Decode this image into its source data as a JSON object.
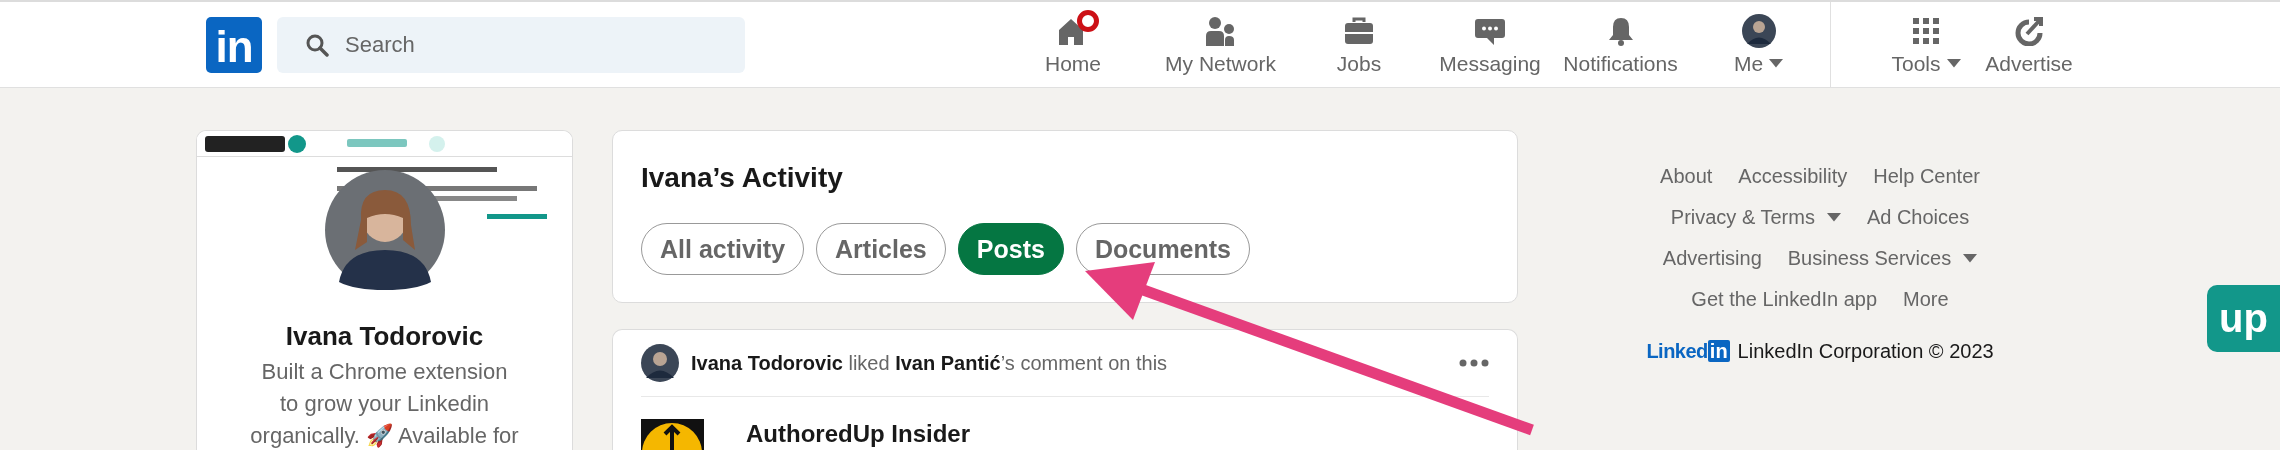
{
  "nav": {
    "logo": "in",
    "search": {
      "placeholder": "Search"
    },
    "items": [
      {
        "label": "Home",
        "kind": "home",
        "dropdown": false,
        "notification": true
      },
      {
        "label": "My Network",
        "kind": "network",
        "dropdown": false,
        "notification": false
      },
      {
        "label": "Jobs",
        "kind": "jobs",
        "dropdown": false,
        "notification": false
      },
      {
        "label": "Messaging",
        "kind": "messaging",
        "dropdown": false,
        "notification": false
      },
      {
        "label": "Notifications",
        "kind": "notifications",
        "dropdown": false,
        "notification": false
      },
      {
        "label": "Me",
        "kind": "me",
        "dropdown": true,
        "notification": false
      },
      {
        "label": "Tools",
        "kind": "tools",
        "dropdown": true,
        "notification": false
      },
      {
        "label": "Advertise",
        "kind": "advertise",
        "dropdown": false,
        "notification": false
      }
    ]
  },
  "profile": {
    "name": "Ivana Todorovic",
    "headline": "Built a Chrome extension\nto grow your Linkedin\norganically. 🚀 Available for"
  },
  "activity": {
    "title": "Ivana’s Activity",
    "filters": [
      {
        "label": "All activity",
        "selected": false
      },
      {
        "label": "Articles",
        "selected": false
      },
      {
        "label": "Posts",
        "selected": true
      },
      {
        "label": "Documents",
        "selected": false
      }
    ]
  },
  "post": {
    "header": "**Ivana Todorovic** liked **Ivan Pantić**’s comment on this",
    "author": "AuthoredUp Insider"
  },
  "footer": {
    "rows": [
      [
        {
          "label": "About",
          "dropdown": false
        },
        {
          "label": "Accessibility",
          "dropdown": false
        },
        {
          "label": "Help Center",
          "dropdown": false
        }
      ],
      [
        {
          "label": "Privacy & Terms",
          "dropdown": true
        },
        {
          "label": "Ad Choices",
          "dropdown": false
        }
      ],
      [
        {
          "label": "Advertising",
          "dropdown": false
        },
        {
          "label": "Business Services",
          "dropdown": true
        }
      ],
      [
        {
          "label": "Get the LinkedIn app",
          "dropdown": false
        },
        {
          "label": "More",
          "dropdown": false
        }
      ]
    ],
    "brand": {
      "word": "Linked",
      "mark": "in"
    },
    "copyright": "LinkedIn Corporation © 2023"
  },
  "extension_badge": {
    "label": "up"
  }
}
